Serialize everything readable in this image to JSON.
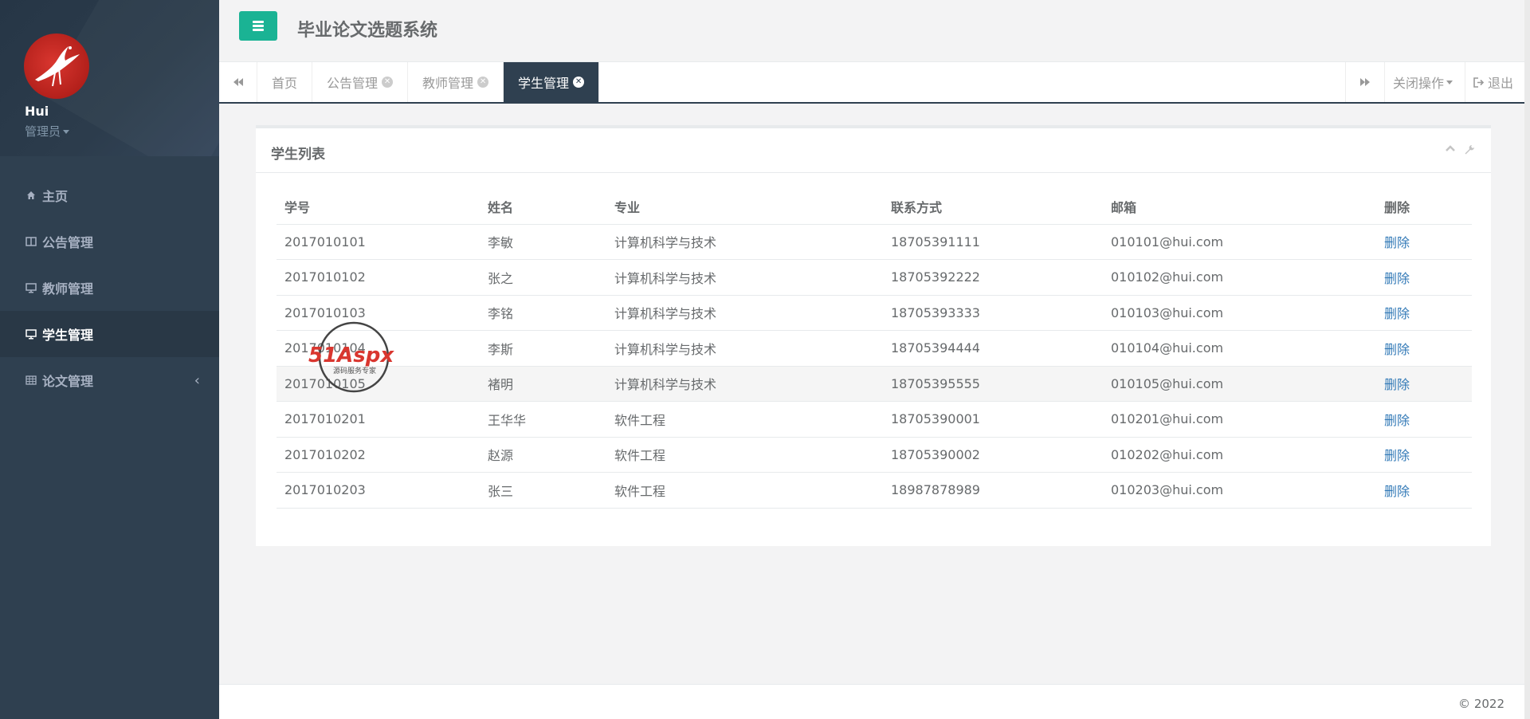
{
  "header": {
    "title": "毕业论文选题系统"
  },
  "profile": {
    "name": "Hui",
    "role": "管理员"
  },
  "sidebar": {
    "items": [
      {
        "label": "主页",
        "icon": "home-icon"
      },
      {
        "label": "公告管理",
        "icon": "columns-icon"
      },
      {
        "label": "教师管理",
        "icon": "desktop-icon"
      },
      {
        "label": "学生管理",
        "icon": "desktop-icon",
        "active": true
      },
      {
        "label": "论文管理",
        "icon": "table-icon",
        "arrow": "‹"
      }
    ]
  },
  "tabs": [
    {
      "label": "首页"
    },
    {
      "label": "公告管理"
    },
    {
      "label": "教师管理"
    },
    {
      "label": "学生管理",
      "active": true
    }
  ],
  "toolbar": {
    "close_ops": "关闭操作",
    "logout": "退出"
  },
  "panel": {
    "title": "学生列表",
    "columns": [
      "学号",
      "姓名",
      "专业",
      "联系方式",
      "邮箱",
      "删除"
    ],
    "rows": [
      [
        "2017010101",
        "李敏",
        "计算机科学与技术",
        "18705391111",
        "010101@hui.com",
        "删除"
      ],
      [
        "2017010102",
        "张之",
        "计算机科学与技术",
        "18705392222",
        "010102@hui.com",
        "删除"
      ],
      [
        "2017010103",
        "李铭",
        "计算机科学与技术",
        "18705393333",
        "010103@hui.com",
        "删除"
      ],
      [
        "2017010104",
        "李斯",
        "计算机科学与技术",
        "18705394444",
        "010104@hui.com",
        "删除"
      ],
      [
        "2017010105",
        "褚明",
        "计算机科学与技术",
        "18705395555",
        "010105@hui.com",
        "删除"
      ],
      [
        "2017010201",
        "王华华",
        "软件工程",
        "18705390001",
        "010201@hui.com",
        "删除"
      ],
      [
        "2017010202",
        "赵源",
        "软件工程",
        "18705390002",
        "010202@hui.com",
        "删除"
      ],
      [
        "2017010203",
        "张三",
        "软件工程",
        "18987878989",
        "010203@hui.com",
        "删除"
      ]
    ]
  },
  "watermark": {
    "brand": "51Aspx",
    "tagline": "源码服务专家"
  },
  "footer": {
    "copyright": "© 2022"
  },
  "colors": {
    "sidebar": "#2f4050",
    "accent": "#1ab394",
    "link": "#337ab7"
  }
}
